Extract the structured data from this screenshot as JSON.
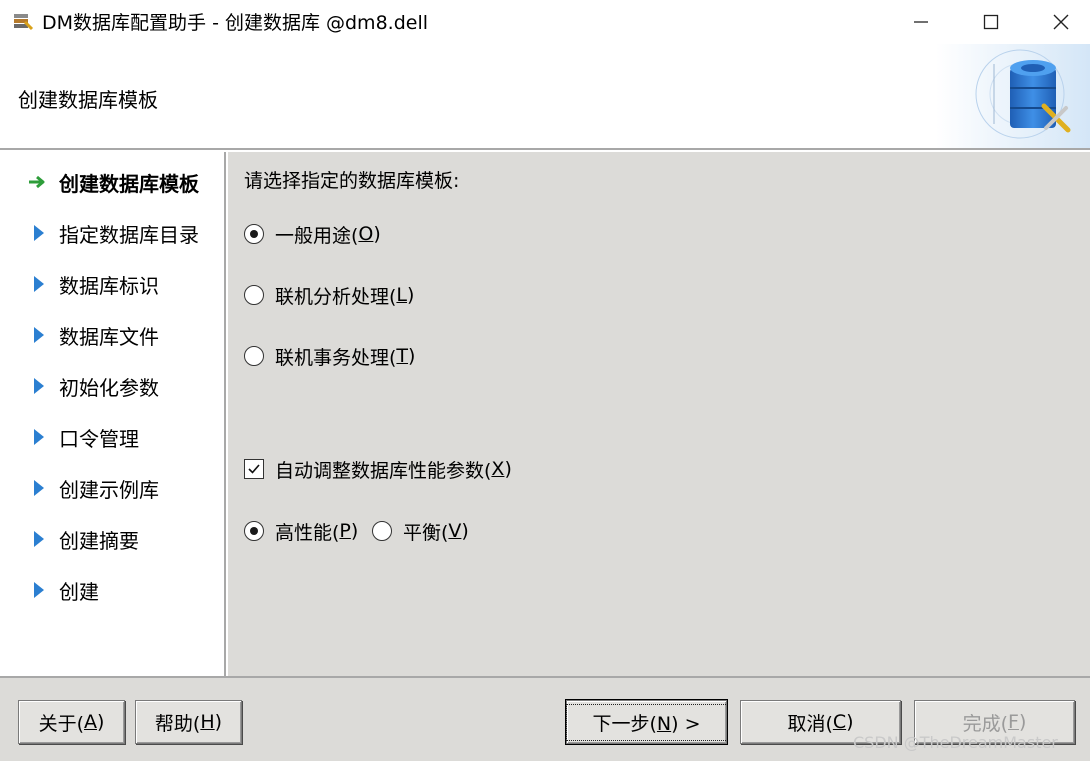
{
  "window": {
    "title": "DM数据库配置助手 - 创建数据库 @dm8.dell",
    "controls": [
      "minimize-icon",
      "maximize-icon",
      "close-icon"
    ]
  },
  "header": {
    "title": "创建数据库模板",
    "logo_icon": "database-wrench-icon"
  },
  "sidebar": {
    "steps": [
      {
        "label": "创建数据库模板",
        "icon": "green-arrow-icon",
        "active": true
      },
      {
        "label": "指定数据库目录",
        "icon": "blue-triangle-icon",
        "active": false
      },
      {
        "label": "数据库标识",
        "icon": "blue-triangle-icon",
        "active": false
      },
      {
        "label": "数据库文件",
        "icon": "blue-triangle-icon",
        "active": false
      },
      {
        "label": "初始化参数",
        "icon": "blue-triangle-icon",
        "active": false
      },
      {
        "label": "口令管理",
        "icon": "blue-triangle-icon",
        "active": false
      },
      {
        "label": "创建示例库",
        "icon": "blue-triangle-icon",
        "active": false
      },
      {
        "label": "创建摘要",
        "icon": "blue-triangle-icon",
        "active": false
      },
      {
        "label": "创建",
        "icon": "blue-triangle-icon",
        "active": false
      }
    ]
  },
  "main": {
    "prompt": "请选择指定的数据库模板:",
    "template_options": [
      {
        "label": "一般用途(",
        "mnemonic": "O",
        "suffix": ")",
        "selected": true
      },
      {
        "label": "联机分析处理(",
        "mnemonic": "L",
        "suffix": ")",
        "selected": false
      },
      {
        "label": "联机事务处理(",
        "mnemonic": "T",
        "suffix": ")",
        "selected": false
      }
    ],
    "auto_tune": {
      "label": "自动调整数据库性能参数(",
      "mnemonic": "X",
      "suffix": ")",
      "checked": true
    },
    "perf_options": [
      {
        "label": "高性能(",
        "mnemonic": "P",
        "suffix": ")",
        "selected": true
      },
      {
        "label": "平衡(",
        "mnemonic": "V",
        "suffix": ")",
        "selected": false
      }
    ]
  },
  "footer": {
    "about": {
      "label": "关于(",
      "mnemonic": "A",
      "suffix": ")"
    },
    "help": {
      "label": "帮助(",
      "mnemonic": "H",
      "suffix": ")"
    },
    "next": {
      "label": "下一步(",
      "mnemonic": "N",
      "suffix": ") >"
    },
    "cancel": {
      "label": "取消(",
      "mnemonic": "C",
      "suffix": ")"
    },
    "finish": {
      "label": "完成(",
      "mnemonic": "F",
      "suffix": ")",
      "enabled": false
    }
  },
  "watermark": "CSDN @TheDreamMaster",
  "colors": {
    "panel_bg": "#dcdbd8",
    "active_arrow": "#2e9d3a",
    "step_arrow": "#2b7fd1",
    "divider": "#a8a8a8"
  }
}
